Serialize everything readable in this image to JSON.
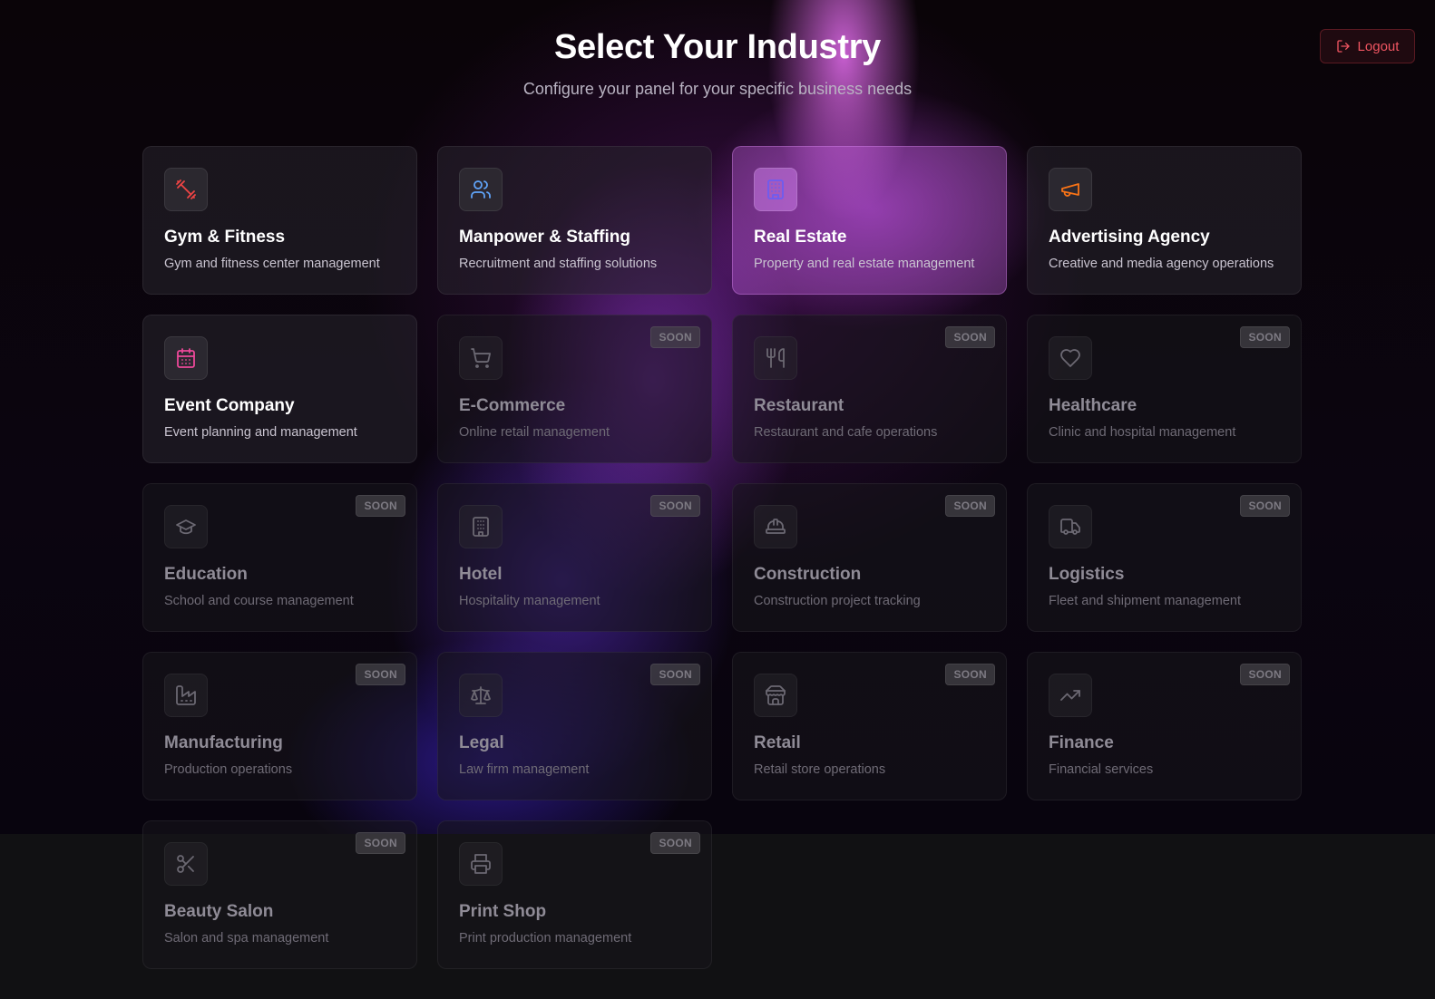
{
  "header": {
    "title": "Select Your Industry",
    "subtitle": "Configure your panel for your specific business needs"
  },
  "logout": {
    "label": "Logout",
    "icon": "logout-icon"
  },
  "colors": {
    "gym": "#ef4444",
    "manpower": "#60a5fa",
    "real_estate": "#6d5cf0",
    "advertising": "#f97316",
    "event": "#ec4899",
    "soon_icon": "#6b6872"
  },
  "industries": [
    {
      "key": "gym",
      "title": "Gym & Fitness",
      "desc": "Gym and fitness center management",
      "icon": "dumbbell-icon",
      "status": "active"
    },
    {
      "key": "manpower",
      "title": "Manpower & Staffing",
      "desc": "Recruitment and staffing solutions",
      "icon": "users-icon",
      "status": "active"
    },
    {
      "key": "real_estate",
      "title": "Real Estate",
      "desc": "Property and real estate management",
      "icon": "building-icon",
      "status": "selected"
    },
    {
      "key": "advertising",
      "title": "Advertising Agency",
      "desc": "Creative and media agency operations",
      "icon": "megaphone-icon",
      "status": "active"
    },
    {
      "key": "event",
      "title": "Event Company",
      "desc": "Event planning and management",
      "icon": "calendar-icon",
      "status": "active"
    },
    {
      "key": "ecommerce",
      "title": "E-Commerce",
      "desc": "Online retail management",
      "icon": "cart-icon",
      "status": "soon",
      "badge": "SOON"
    },
    {
      "key": "restaurant",
      "title": "Restaurant",
      "desc": "Restaurant and cafe operations",
      "icon": "utensils-icon",
      "status": "soon",
      "badge": "SOON"
    },
    {
      "key": "healthcare",
      "title": "Healthcare",
      "desc": "Clinic and hospital management",
      "icon": "heart-icon",
      "status": "soon",
      "badge": "SOON"
    },
    {
      "key": "education",
      "title": "Education",
      "desc": "School and course management",
      "icon": "graduation-cap-icon",
      "status": "soon",
      "badge": "SOON"
    },
    {
      "key": "hotel",
      "title": "Hotel",
      "desc": "Hospitality management",
      "icon": "hotel-icon",
      "status": "soon",
      "badge": "SOON"
    },
    {
      "key": "construction",
      "title": "Construction",
      "desc": "Construction project tracking",
      "icon": "hard-hat-icon",
      "status": "soon",
      "badge": "SOON"
    },
    {
      "key": "logistics",
      "title": "Logistics",
      "desc": "Fleet and shipment management",
      "icon": "truck-icon",
      "status": "soon",
      "badge": "SOON"
    },
    {
      "key": "manufacturing",
      "title": "Manufacturing",
      "desc": "Production operations",
      "icon": "factory-icon",
      "status": "soon",
      "badge": "SOON"
    },
    {
      "key": "legal",
      "title": "Legal",
      "desc": "Law firm management",
      "icon": "scale-icon",
      "status": "soon",
      "badge": "SOON"
    },
    {
      "key": "retail",
      "title": "Retail",
      "desc": "Retail store operations",
      "icon": "store-icon",
      "status": "soon",
      "badge": "SOON"
    },
    {
      "key": "finance",
      "title": "Finance",
      "desc": "Financial services",
      "icon": "trending-up-icon",
      "status": "soon",
      "badge": "SOON"
    },
    {
      "key": "beauty",
      "title": "Beauty Salon",
      "desc": "Salon and spa management",
      "icon": "scissors-icon",
      "status": "soon",
      "badge": "SOON"
    },
    {
      "key": "print",
      "title": "Print Shop",
      "desc": "Print production management",
      "icon": "printer-icon",
      "status": "soon",
      "badge": "SOON"
    }
  ]
}
